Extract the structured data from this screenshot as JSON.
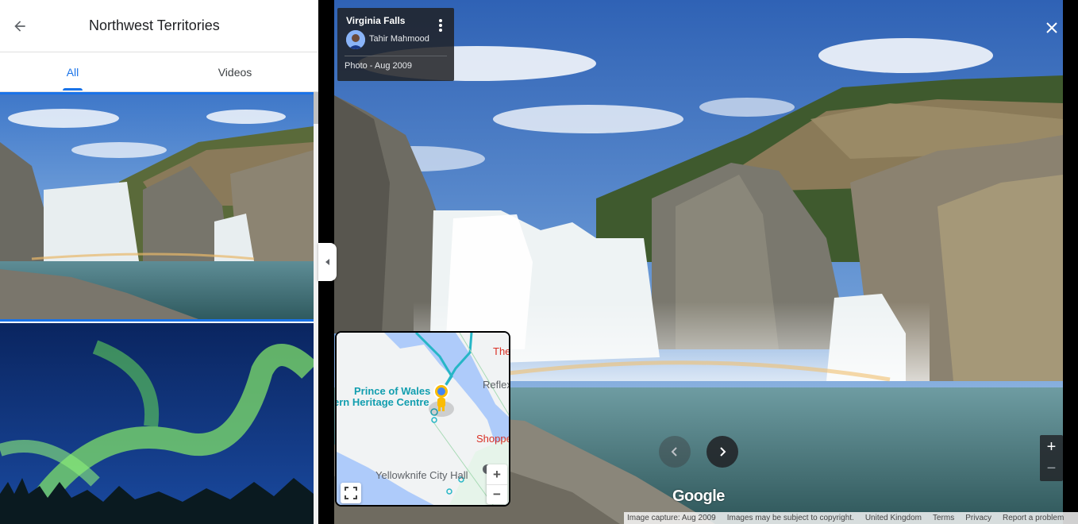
{
  "panel": {
    "title": "Northwest Territories",
    "tabs": [
      {
        "label": "All",
        "active": true
      },
      {
        "label": "Videos",
        "active": false
      }
    ]
  },
  "photo": {
    "title": "Virginia Falls",
    "author": "Tahir Mahmood",
    "date": "Photo - Aug 2009"
  },
  "minimap": {
    "labels": {
      "prince": "Prince of Wales",
      "heritage": "ern Heritage Centre",
      "the": "The",
      "reflex": "Reflex",
      "shopp": "Shoppe",
      "cityhall": "Yellowknife City Hall"
    },
    "zoom_in": "+",
    "zoom_out": "−"
  },
  "controls": {
    "zoom_in": "+",
    "zoom_out": "−",
    "google": "Google"
  },
  "footer": {
    "capture": "Image capture: Aug 2009",
    "copyright": "Images may be subject to copyright.",
    "region": "United Kingdom",
    "terms": "Terms",
    "privacy": "Privacy",
    "report": "Report a problem"
  },
  "colors": {
    "accent": "#1a73e8",
    "card_bg": "#202124"
  }
}
